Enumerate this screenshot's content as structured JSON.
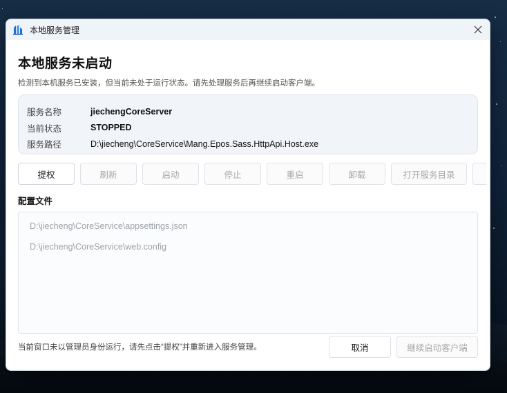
{
  "window": {
    "title": "本地服务管理",
    "close_icon": "close-icon",
    "app_icon": "app-logo-icon"
  },
  "main": {
    "heading": "本地服务未启动",
    "description": "检测到本机服务已安装，但当前未处于运行状态。请先处理服务后再继续启动客户端。"
  },
  "service_info": {
    "name_label": "服务名称",
    "name_value": "jiechengCoreServer",
    "status_label": "当前状态",
    "status_value": "STOPPED",
    "path_label": "服务路径",
    "path_value": "D:\\jiecheng\\CoreService\\Mang.Epos.Sass.HttpApi.Host.exe"
  },
  "actions": {
    "elevate": "提权",
    "refresh": "刷新",
    "start": "启动",
    "stop": "停止",
    "restart": "重启",
    "uninstall": "卸载",
    "open_dir": "打开服务目录"
  },
  "config": {
    "label": "配置文件",
    "files": [
      "D:\\jiecheng\\CoreService\\appsettings.json",
      "D:\\jiecheng\\CoreService\\web.config"
    ]
  },
  "footer": {
    "note": "当前窗口未以管理员身份运行，请先点击“提权”并重新进入服务管理。",
    "cancel": "取消",
    "continue": "继续启动客户端"
  },
  "colors": {
    "titlebar_bg": "#eef4f8",
    "card_bg": "#f1f5f9",
    "disabled_text": "#a8a8a8",
    "logo_blue": "#1e6fd9"
  }
}
